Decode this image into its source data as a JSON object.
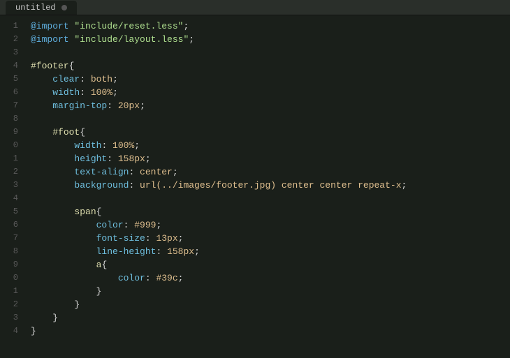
{
  "titleBar": {
    "tabLabel": "untitled",
    "tabDot": true
  },
  "editor": {
    "lines": [
      {
        "number": "1",
        "content": "@import \"include/reset.less\";",
        "type": "import"
      },
      {
        "number": "2",
        "content": "@import \"include/layout.less\";",
        "type": "import"
      },
      {
        "number": "3",
        "content": "",
        "type": "blank"
      },
      {
        "number": "4",
        "content": "#footer{",
        "type": "selector"
      },
      {
        "number": "5",
        "content": "    clear: both;",
        "type": "property"
      },
      {
        "number": "6",
        "content": "    width: 100%;",
        "type": "property"
      },
      {
        "number": "7",
        "content": "    margin-top: 20px;",
        "type": "property"
      },
      {
        "number": "8",
        "content": "",
        "type": "blank"
      },
      {
        "number": "9",
        "content": "    #foot{",
        "type": "selector"
      },
      {
        "number": "0",
        "content": "        width: 100%;",
        "type": "property"
      },
      {
        "number": "1",
        "content": "        height: 158px;",
        "type": "property"
      },
      {
        "number": "2",
        "content": "        text-align: center;",
        "type": "property"
      },
      {
        "number": "3",
        "content": "        background: url(../images/footer.jpg) center center repeat-x;",
        "type": "property"
      },
      {
        "number": "4",
        "content": "",
        "type": "blank"
      },
      {
        "number": "5",
        "content": "        span{",
        "type": "selector"
      },
      {
        "number": "6",
        "content": "            color: #999;",
        "type": "property"
      },
      {
        "number": "7",
        "content": "            font-size: 13px;",
        "type": "property"
      },
      {
        "number": "8",
        "content": "            line-height: 158px;",
        "type": "property"
      },
      {
        "number": "9",
        "content": "            a{",
        "type": "selector"
      },
      {
        "number": "0",
        "content": "                color: #39c;",
        "type": "property"
      },
      {
        "number": "1",
        "content": "            }",
        "type": "brace"
      },
      {
        "number": "2",
        "content": "        }",
        "type": "brace"
      },
      {
        "number": "3",
        "content": "    }",
        "type": "brace"
      },
      {
        "number": "4",
        "content": "}",
        "type": "brace"
      }
    ]
  }
}
